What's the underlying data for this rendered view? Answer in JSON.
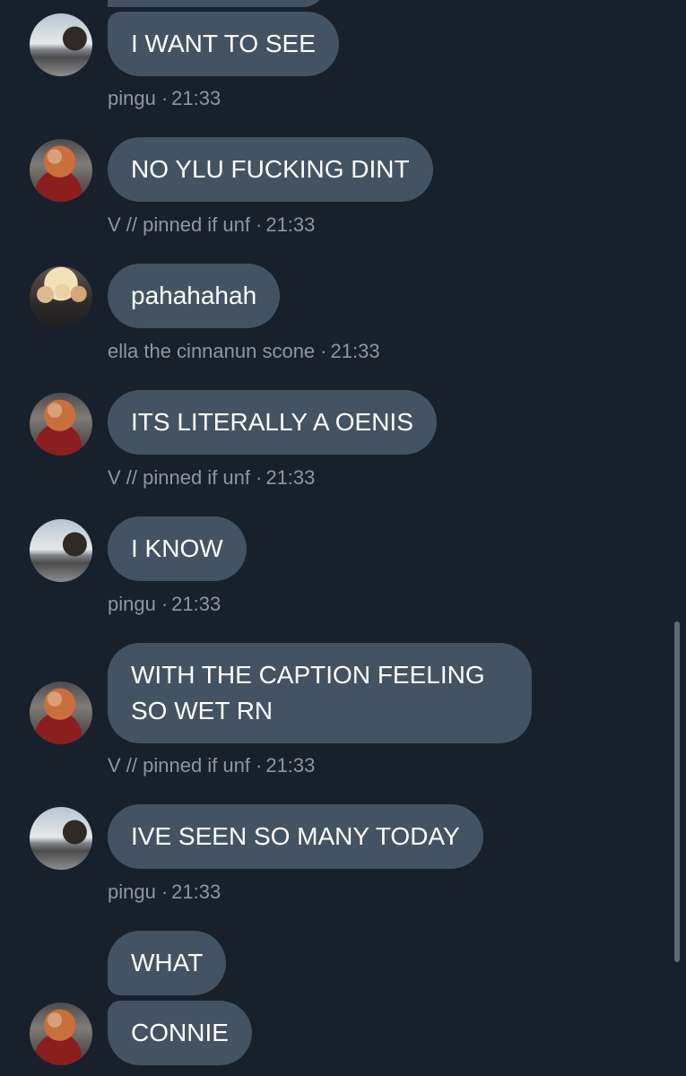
{
  "messages": [
    {
      "author": "pingu",
      "time": "21:33",
      "lines": [
        "I WANT TO SEE"
      ]
    },
    {
      "author": "V // pinned if unf",
      "time": "21:33",
      "lines": [
        "NO YLU FUCKING DINT"
      ]
    },
    {
      "author": "ella the cinnanun scone",
      "time": "21:33",
      "lines": [
        "pahahahah"
      ]
    },
    {
      "author": "V // pinned if unf",
      "time": "21:33",
      "lines": [
        "ITS LITERALLY A OENIS"
      ]
    },
    {
      "author": "pingu",
      "time": "21:33",
      "lines": [
        "I KNOW"
      ]
    },
    {
      "author": "V // pinned if unf",
      "time": "21:33",
      "lines": [
        "WITH THE CAPTION FEELING SO WET RN"
      ]
    },
    {
      "author": "pingu",
      "time": "21:33",
      "lines": [
        "IVE SEEN SO MANY TODAY"
      ]
    },
    {
      "author": "",
      "time": "",
      "lines": [
        "WHAT",
        "CONNIE"
      ]
    }
  ],
  "meta_separator": "·",
  "colors": {
    "background": "#17202b",
    "bubble": "#435363",
    "meta_text": "#8a98a6"
  }
}
